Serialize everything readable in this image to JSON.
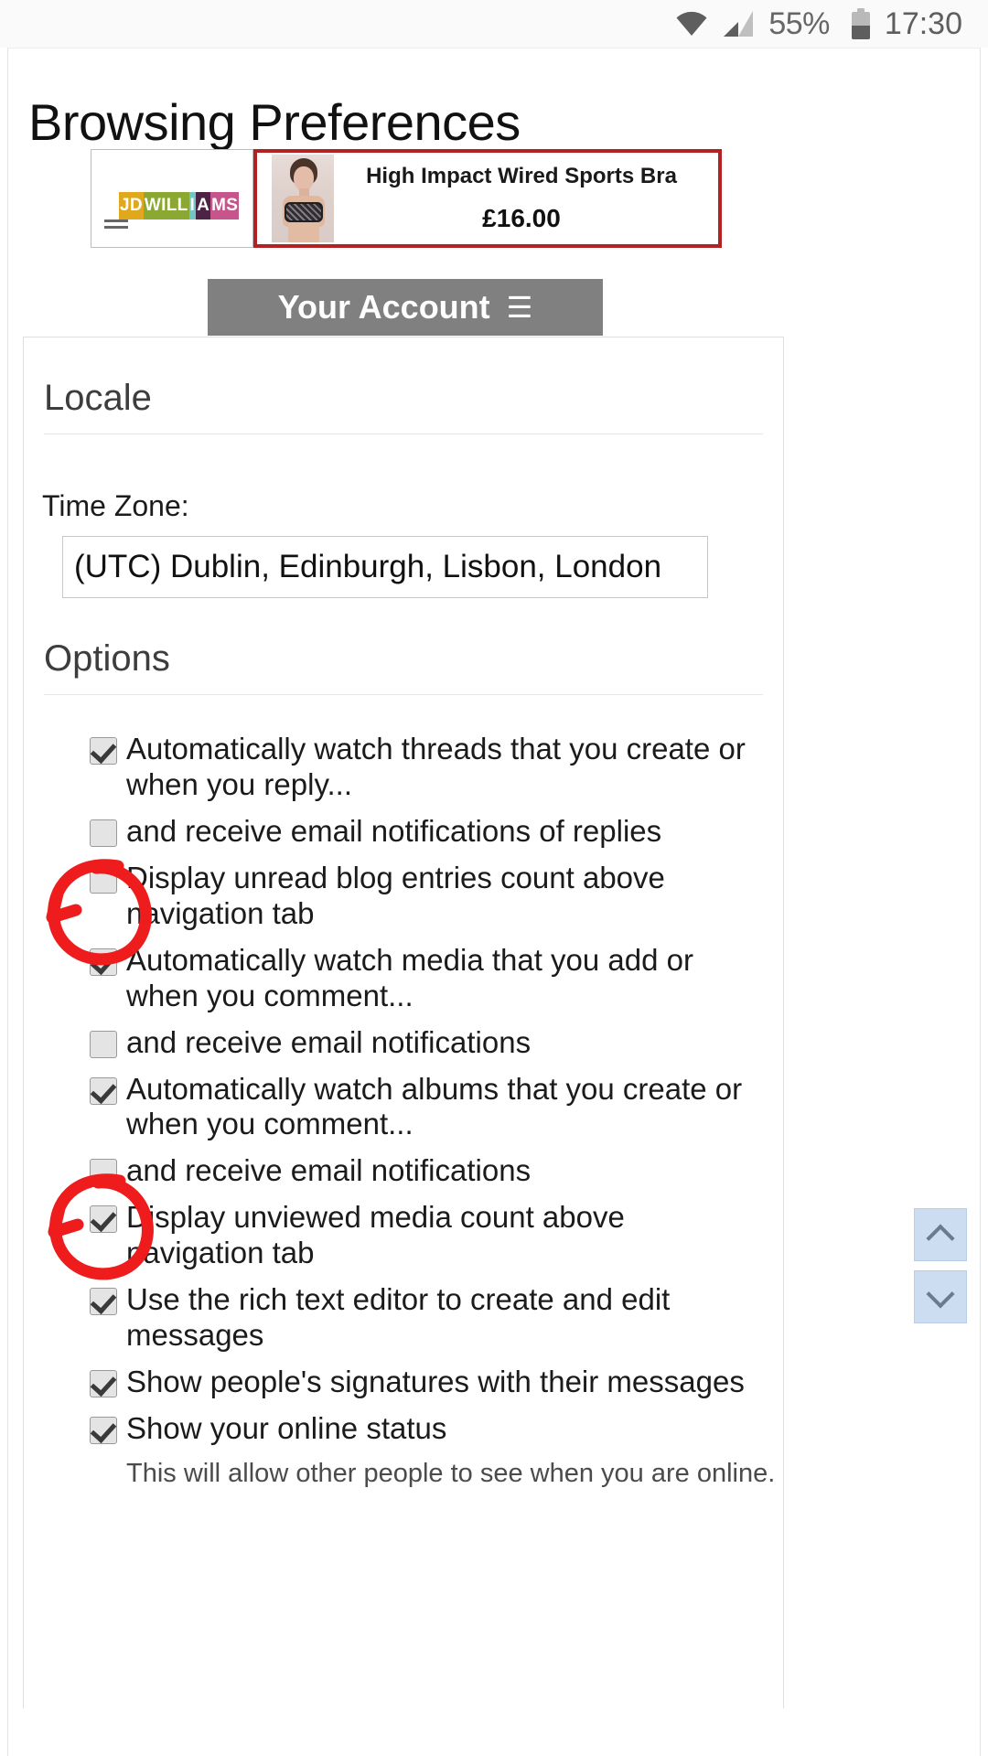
{
  "statusbar": {
    "battery_percent": "55%",
    "time": "17:30",
    "icons": [
      "wifi-icon",
      "signal-icon",
      "battery-icon"
    ]
  },
  "page": {
    "title": "Browsing Preferences"
  },
  "ad": {
    "brand": "JDWILLIAMS",
    "brand_segments": [
      "JD",
      "WILL",
      "I",
      "A",
      "MS"
    ],
    "product_title": "High Impact Wired Sports Bra",
    "price": "£16.00",
    "border_color": "#b22222",
    "menu_icon": "hamburger-icon"
  },
  "account_bar": {
    "label": "Your Account",
    "menu_glyph": "☰",
    "background": "#808080"
  },
  "locale": {
    "heading": "Locale",
    "timezone_label": "Time Zone:",
    "timezone_value": "(UTC) Dublin, Edinburgh, Lisbon, London"
  },
  "options": {
    "heading": "Options",
    "items": [
      {
        "checked": true,
        "indent": false,
        "label": "Automatically watch threads that you create or when you reply..."
      },
      {
        "checked": false,
        "indent": true,
        "label": "and receive email notifications of replies"
      },
      {
        "checked": false,
        "indent": false,
        "label": "Display unread blog entries count above navigation tab"
      },
      {
        "checked": true,
        "indent": false,
        "label": "Automatically watch media that you add or when you comment..."
      },
      {
        "checked": false,
        "indent": true,
        "label": "and receive email notifications"
      },
      {
        "checked": true,
        "indent": false,
        "label": "Automatically watch albums that you create or when you comment..."
      },
      {
        "checked": false,
        "indent": true,
        "label": "and receive email notifications"
      },
      {
        "checked": true,
        "indent": false,
        "label": "Display unviewed media count above navigation tab"
      },
      {
        "checked": true,
        "indent": false,
        "label": "Use the rich text editor to create and edit messages"
      },
      {
        "checked": true,
        "indent": false,
        "label": "Show people's signatures with their messages"
      },
      {
        "checked": true,
        "indent": false,
        "label": "Show your online status",
        "sub": "This will allow other people to see when you are online."
      }
    ]
  },
  "annotations": {
    "color": "#ee1c1c",
    "circles": [
      {
        "name": "highlight-blog-entries-checkbox"
      },
      {
        "name": "highlight-unviewed-media-checkbox"
      }
    ]
  },
  "scroll_controls": {
    "up_icon": "chevron-up-icon",
    "down_icon": "chevron-down-icon",
    "color": "#ccdcf1"
  }
}
